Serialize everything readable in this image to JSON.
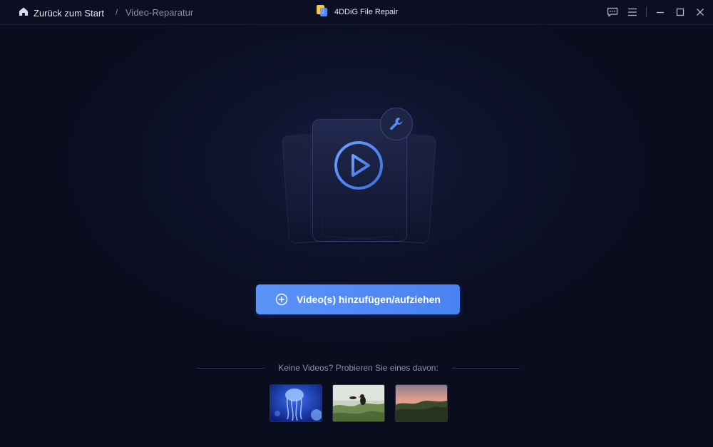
{
  "titlebar": {
    "back_label": "Zurück zum Start",
    "separator": "/",
    "breadcrumb": "Video-Reparatur",
    "app_title": "4DDiG File Repair",
    "icons": [
      "home-icon",
      "feedback-icon",
      "menu-icon",
      "minimize-icon",
      "maximize-icon",
      "close-icon"
    ]
  },
  "hero": {
    "icons": [
      "play-icon",
      "wrench-icon"
    ]
  },
  "main": {
    "add_button_label": "Video(s) hinzufügen/aufziehen",
    "add_icon": "plus-circle-icon",
    "accent_color": "#4f8af5"
  },
  "samples": {
    "label": "Keine Videos? Probieren Sie eines davon:",
    "items": [
      "jellyfish",
      "puffin",
      "sunset-forest"
    ]
  }
}
